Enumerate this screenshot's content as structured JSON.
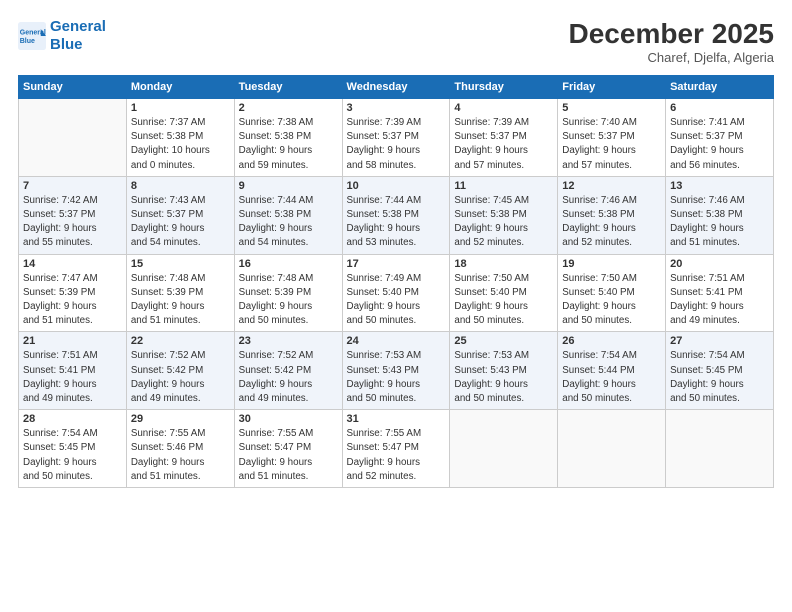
{
  "logo": {
    "line1": "General",
    "line2": "Blue"
  },
  "title": "December 2025",
  "subtitle": "Charef, Djelfa, Algeria",
  "header_days": [
    "Sunday",
    "Monday",
    "Tuesday",
    "Wednesday",
    "Thursday",
    "Friday",
    "Saturday"
  ],
  "weeks": [
    [
      {
        "date": "",
        "info": ""
      },
      {
        "date": "1",
        "info": "Sunrise: 7:37 AM\nSunset: 5:38 PM\nDaylight: 10 hours\nand 0 minutes."
      },
      {
        "date": "2",
        "info": "Sunrise: 7:38 AM\nSunset: 5:38 PM\nDaylight: 9 hours\nand 59 minutes."
      },
      {
        "date": "3",
        "info": "Sunrise: 7:39 AM\nSunset: 5:37 PM\nDaylight: 9 hours\nand 58 minutes."
      },
      {
        "date": "4",
        "info": "Sunrise: 7:39 AM\nSunset: 5:37 PM\nDaylight: 9 hours\nand 57 minutes."
      },
      {
        "date": "5",
        "info": "Sunrise: 7:40 AM\nSunset: 5:37 PM\nDaylight: 9 hours\nand 57 minutes."
      },
      {
        "date": "6",
        "info": "Sunrise: 7:41 AM\nSunset: 5:37 PM\nDaylight: 9 hours\nand 56 minutes."
      }
    ],
    [
      {
        "date": "7",
        "info": "Sunrise: 7:42 AM\nSunset: 5:37 PM\nDaylight: 9 hours\nand 55 minutes."
      },
      {
        "date": "8",
        "info": "Sunrise: 7:43 AM\nSunset: 5:37 PM\nDaylight: 9 hours\nand 54 minutes."
      },
      {
        "date": "9",
        "info": "Sunrise: 7:44 AM\nSunset: 5:38 PM\nDaylight: 9 hours\nand 54 minutes."
      },
      {
        "date": "10",
        "info": "Sunrise: 7:44 AM\nSunset: 5:38 PM\nDaylight: 9 hours\nand 53 minutes."
      },
      {
        "date": "11",
        "info": "Sunrise: 7:45 AM\nSunset: 5:38 PM\nDaylight: 9 hours\nand 52 minutes."
      },
      {
        "date": "12",
        "info": "Sunrise: 7:46 AM\nSunset: 5:38 PM\nDaylight: 9 hours\nand 52 minutes."
      },
      {
        "date": "13",
        "info": "Sunrise: 7:46 AM\nSunset: 5:38 PM\nDaylight: 9 hours\nand 51 minutes."
      }
    ],
    [
      {
        "date": "14",
        "info": "Sunrise: 7:47 AM\nSunset: 5:39 PM\nDaylight: 9 hours\nand 51 minutes."
      },
      {
        "date": "15",
        "info": "Sunrise: 7:48 AM\nSunset: 5:39 PM\nDaylight: 9 hours\nand 51 minutes."
      },
      {
        "date": "16",
        "info": "Sunrise: 7:48 AM\nSunset: 5:39 PM\nDaylight: 9 hours\nand 50 minutes."
      },
      {
        "date": "17",
        "info": "Sunrise: 7:49 AM\nSunset: 5:40 PM\nDaylight: 9 hours\nand 50 minutes."
      },
      {
        "date": "18",
        "info": "Sunrise: 7:50 AM\nSunset: 5:40 PM\nDaylight: 9 hours\nand 50 minutes."
      },
      {
        "date": "19",
        "info": "Sunrise: 7:50 AM\nSunset: 5:40 PM\nDaylight: 9 hours\nand 50 minutes."
      },
      {
        "date": "20",
        "info": "Sunrise: 7:51 AM\nSunset: 5:41 PM\nDaylight: 9 hours\nand 49 minutes."
      }
    ],
    [
      {
        "date": "21",
        "info": "Sunrise: 7:51 AM\nSunset: 5:41 PM\nDaylight: 9 hours\nand 49 minutes."
      },
      {
        "date": "22",
        "info": "Sunrise: 7:52 AM\nSunset: 5:42 PM\nDaylight: 9 hours\nand 49 minutes."
      },
      {
        "date": "23",
        "info": "Sunrise: 7:52 AM\nSunset: 5:42 PM\nDaylight: 9 hours\nand 49 minutes."
      },
      {
        "date": "24",
        "info": "Sunrise: 7:53 AM\nSunset: 5:43 PM\nDaylight: 9 hours\nand 50 minutes."
      },
      {
        "date": "25",
        "info": "Sunrise: 7:53 AM\nSunset: 5:43 PM\nDaylight: 9 hours\nand 50 minutes."
      },
      {
        "date": "26",
        "info": "Sunrise: 7:54 AM\nSunset: 5:44 PM\nDaylight: 9 hours\nand 50 minutes."
      },
      {
        "date": "27",
        "info": "Sunrise: 7:54 AM\nSunset: 5:45 PM\nDaylight: 9 hours\nand 50 minutes."
      }
    ],
    [
      {
        "date": "28",
        "info": "Sunrise: 7:54 AM\nSunset: 5:45 PM\nDaylight: 9 hours\nand 50 minutes."
      },
      {
        "date": "29",
        "info": "Sunrise: 7:55 AM\nSunset: 5:46 PM\nDaylight: 9 hours\nand 51 minutes."
      },
      {
        "date": "30",
        "info": "Sunrise: 7:55 AM\nSunset: 5:47 PM\nDaylight: 9 hours\nand 51 minutes."
      },
      {
        "date": "31",
        "info": "Sunrise: 7:55 AM\nSunset: 5:47 PM\nDaylight: 9 hours\nand 52 minutes."
      },
      {
        "date": "",
        "info": ""
      },
      {
        "date": "",
        "info": ""
      },
      {
        "date": "",
        "info": ""
      }
    ]
  ]
}
